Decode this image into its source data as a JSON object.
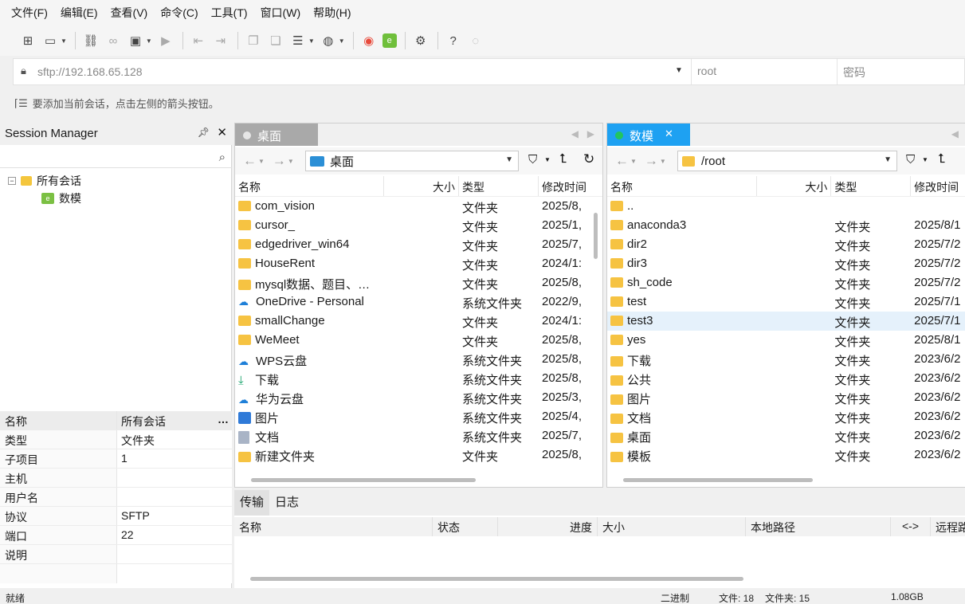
{
  "menu": [
    "文件(F)",
    "编辑(E)",
    "查看(V)",
    "命令(C)",
    "工具(T)",
    "窗口(W)",
    "帮助(H)"
  ],
  "address": {
    "url": "sftp://192.168.65.128",
    "user_placeholder": "root",
    "pass_placeholder": "密码"
  },
  "hint": "要添加当前会话，点击左侧的箭头按钮。",
  "session": {
    "title": "Session Manager",
    "tree_root": "所有会话",
    "tree_child": "数模",
    "props_header": {
      "k": "名称",
      "v": "所有会话"
    },
    "props": [
      {
        "k": "类型",
        "v": "文件夹"
      },
      {
        "k": "子项目",
        "v": "1"
      },
      {
        "k": "主机",
        "v": ""
      },
      {
        "k": "用户名",
        "v": ""
      },
      {
        "k": "协议",
        "v": "SFTP"
      },
      {
        "k": "端口",
        "v": "22"
      },
      {
        "k": "说明",
        "v": ""
      }
    ]
  },
  "left": {
    "tab": "桌面",
    "path": "桌面",
    "cols": {
      "name": "名称",
      "size": "大小",
      "type": "类型",
      "mtime": "修改时间"
    },
    "rows": [
      {
        "name": "com_vision",
        "type": "文件夹",
        "mtime": "2025/8,",
        "icon": "folder"
      },
      {
        "name": "cursor_",
        "type": "文件夹",
        "mtime": "2025/1,",
        "icon": "folder"
      },
      {
        "name": "edgedriver_win64",
        "type": "文件夹",
        "mtime": "2025/7,",
        "icon": "folder"
      },
      {
        "name": "HouseRent",
        "type": "文件夹",
        "mtime": "2024/1:",
        "icon": "folder"
      },
      {
        "name": "mysql数据、题目、…",
        "type": "文件夹",
        "mtime": "2025/8,",
        "icon": "folder"
      },
      {
        "name": "OneDrive - Personal",
        "type": "系统文件夹",
        "mtime": "2022/9,",
        "icon": "cloud"
      },
      {
        "name": "smallChange",
        "type": "文件夹",
        "mtime": "2024/1:",
        "icon": "folder"
      },
      {
        "name": "WeMeet",
        "type": "文件夹",
        "mtime": "2025/8,",
        "icon": "folder"
      },
      {
        "name": "WPS云盘",
        "type": "系统文件夹",
        "mtime": "2025/8,",
        "icon": "cloud"
      },
      {
        "name": "下载",
        "type": "系统文件夹",
        "mtime": "2025/8,",
        "icon": "download"
      },
      {
        "name": "华为云盘",
        "type": "系统文件夹",
        "mtime": "2025/3,",
        "icon": "cloud"
      },
      {
        "name": "图片",
        "type": "系统文件夹",
        "mtime": "2025/4,",
        "icon": "image"
      },
      {
        "name": "文档",
        "type": "系统文件夹",
        "mtime": "2025/7,",
        "icon": "doc"
      },
      {
        "name": "新建文件夹",
        "type": "文件夹",
        "mtime": "2025/8,",
        "icon": "folder"
      }
    ]
  },
  "right": {
    "tab": "数模",
    "path": "/root",
    "cols": {
      "name": "名称",
      "size": "大小",
      "type": "类型",
      "mtime": "修改时间"
    },
    "rows": [
      {
        "name": "..",
        "type": "",
        "mtime": ""
      },
      {
        "name": "anaconda3",
        "type": "文件夹",
        "mtime": "2025/8/1"
      },
      {
        "name": "dir2",
        "type": "文件夹",
        "mtime": "2025/7/2"
      },
      {
        "name": "dir3",
        "type": "文件夹",
        "mtime": "2025/7/2"
      },
      {
        "name": "sh_code",
        "type": "文件夹",
        "mtime": "2025/7/2"
      },
      {
        "name": "test",
        "type": "文件夹",
        "mtime": "2025/7/1"
      },
      {
        "name": "test3",
        "type": "文件夹",
        "mtime": "2025/7/1"
      },
      {
        "name": "yes",
        "type": "文件夹",
        "mtime": "2025/8/1"
      },
      {
        "name": "下载",
        "type": "文件夹",
        "mtime": "2023/6/2"
      },
      {
        "name": "公共",
        "type": "文件夹",
        "mtime": "2023/6/2"
      },
      {
        "name": "图片",
        "type": "文件夹",
        "mtime": "2023/6/2"
      },
      {
        "name": "文档",
        "type": "文件夹",
        "mtime": "2023/6/2"
      },
      {
        "name": "桌面",
        "type": "文件夹",
        "mtime": "2023/6/2"
      },
      {
        "name": "模板",
        "type": "文件夹",
        "mtime": "2023/6/2"
      }
    ]
  },
  "transfer": {
    "tabs": [
      "传输",
      "日志"
    ],
    "cols": [
      "名称",
      "状态",
      "进度",
      "大小",
      "本地路径",
      "<->",
      "远程路"
    ]
  },
  "status": {
    "left": "就绪",
    "mode": "二进制",
    "files": "文件: 18",
    "folders": "文件夹: 15",
    "size": "1.08GB"
  }
}
